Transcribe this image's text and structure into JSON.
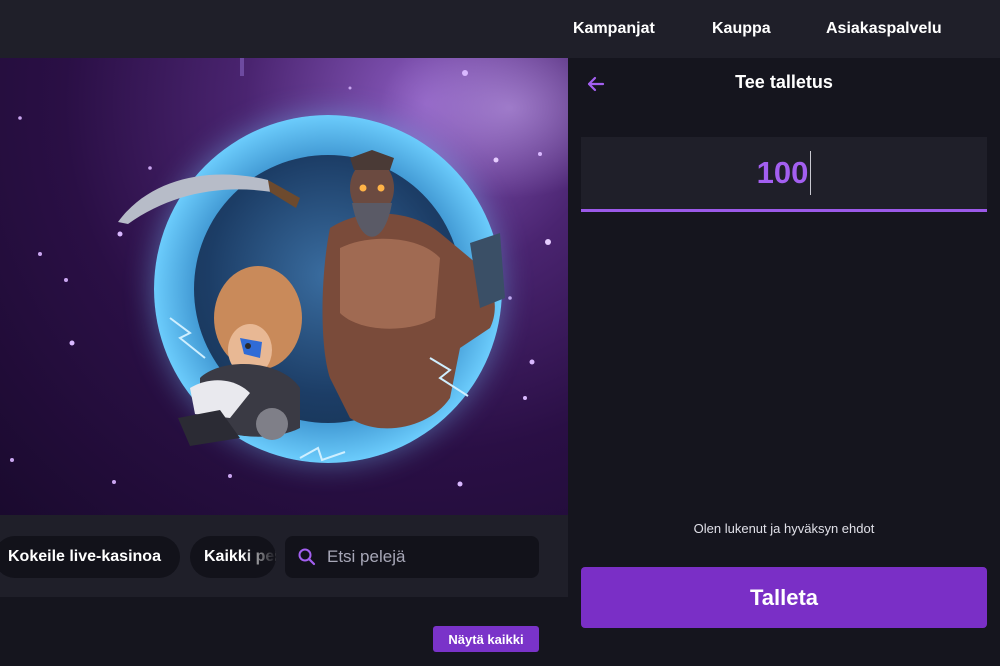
{
  "header": {
    "nav": [
      {
        "label": "Kampanjat"
      },
      {
        "label": "Kauppa"
      },
      {
        "label": "Asiakaspalvelu"
      }
    ]
  },
  "hero": {
    "image": "vikings-game-banner"
  },
  "controls": {
    "live_casino_label": "Kokeile live-kasinoa",
    "all_games_label": "Kaikki pelit",
    "search_placeholder": "Etsi pelejä"
  },
  "lower": {
    "show_all_label": "Näytä kaikki"
  },
  "deposit_panel": {
    "title": "Tee talletus",
    "amount": "100",
    "terms_text": "Olen lukenut ja hyväksyn ehdot",
    "submit_label": "Talleta"
  },
  "colors": {
    "accent": "#7a2fc6",
    "amount_text": "#a35ff0",
    "background": "#15151e",
    "surface": "#1f1f29"
  }
}
